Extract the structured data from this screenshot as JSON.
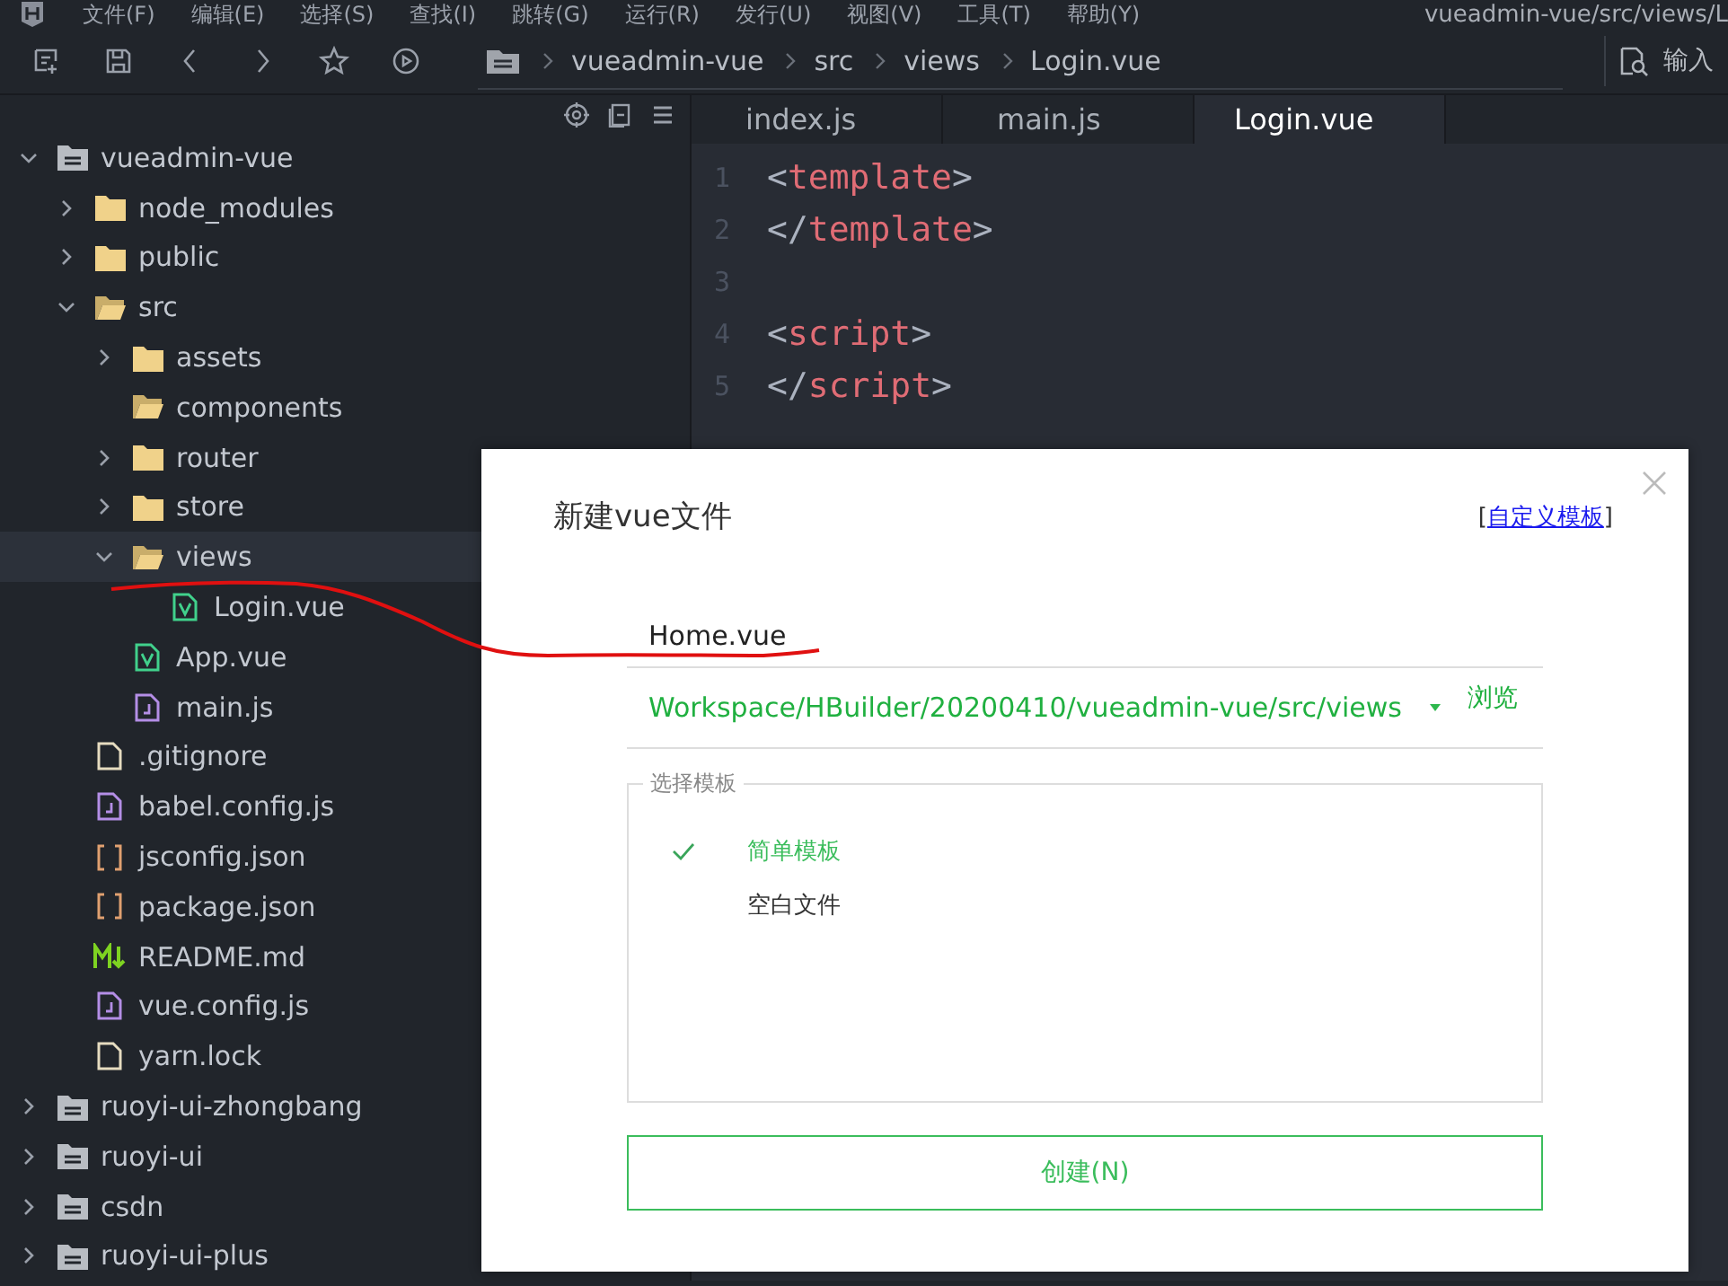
{
  "menu": [
    "文件(F)",
    "编辑(E)",
    "选择(S)",
    "查找(I)",
    "跳转(G)",
    "运行(R)",
    "发行(U)",
    "视图(V)",
    "工具(T)",
    "帮助(Y)"
  ],
  "window": {
    "title": "vueadmin-vue/src/views/L"
  },
  "toolbar": {
    "buttons": [
      {
        "kind": "new"
      },
      {
        "kind": "save"
      },
      {
        "kind": "back"
      },
      {
        "kind": "forward"
      },
      {
        "kind": "star"
      },
      {
        "kind": "run"
      }
    ],
    "breadcrumb": [
      "vueadmin-vue",
      "src",
      "views",
      "Login.vue"
    ],
    "search_placeholder": "输入"
  },
  "tree": [
    {
      "label": "vueadmin-vue",
      "kind": "project",
      "expanded": true,
      "selected": false,
      "children": [
        {
          "label": "node_modules",
          "kind": "folder",
          "expanded": false,
          "selected": false
        },
        {
          "label": "public",
          "kind": "folder",
          "expanded": false,
          "selected": false
        },
        {
          "label": "src",
          "kind": "folder",
          "expanded": true,
          "selected": false,
          "children": [
            {
              "label": "assets",
              "kind": "folder",
              "expanded": false,
              "selected": false
            },
            {
              "label": "components",
              "kind": "empty-folder",
              "selected": false
            },
            {
              "label": "router",
              "kind": "folder",
              "expanded": false,
              "selected": false
            },
            {
              "label": "store",
              "kind": "folder",
              "expanded": false,
              "selected": false
            },
            {
              "label": "views",
              "kind": "folder",
              "expanded": true,
              "selected": true,
              "children": [
                {
                  "label": "Login.vue",
                  "kind": "vue",
                  "selected": false
                }
              ]
            },
            {
              "label": "App.vue",
              "kind": "vue",
              "selected": false
            },
            {
              "label": "main.js",
              "kind": "js",
              "selected": false
            }
          ]
        },
        {
          "label": ".gitignore",
          "kind": "file",
          "selected": false
        },
        {
          "label": "babel.config.js",
          "kind": "js",
          "selected": false
        },
        {
          "label": "jsconfig.json",
          "kind": "json",
          "selected": false
        },
        {
          "label": "package.json",
          "kind": "json",
          "selected": false
        },
        {
          "label": "README.md",
          "kind": "md",
          "selected": false
        },
        {
          "label": "vue.config.js",
          "kind": "js",
          "selected": false
        },
        {
          "label": "yarn.lock",
          "kind": "file",
          "selected": false
        }
      ]
    },
    {
      "label": "ruoyi-ui-zhongbang",
      "kind": "project",
      "expanded": false,
      "selected": false
    },
    {
      "label": "ruoyi-ui",
      "kind": "project",
      "expanded": false,
      "selected": false
    },
    {
      "label": "csdn",
      "kind": "project",
      "expanded": false,
      "selected": false
    },
    {
      "label": "ruoyi-ui-plus",
      "kind": "project",
      "expanded": false,
      "selected": false
    }
  ],
  "tabs": [
    {
      "label": "index.js",
      "selected": false
    },
    {
      "label": "main.js",
      "selected": false
    },
    {
      "label": "Login.vue",
      "selected": true
    }
  ],
  "editor": {
    "lines": [
      {
        "number": "1",
        "tokens": [
          {
            "text": "<",
            "kind": "punct"
          },
          {
            "text": "template",
            "kind": "tag"
          },
          {
            "text": ">",
            "kind": "punct"
          }
        ]
      },
      {
        "number": "2",
        "tokens": [
          {
            "text": "</",
            "kind": "punct"
          },
          {
            "text": "template",
            "kind": "tag"
          },
          {
            "text": ">",
            "kind": "punct"
          }
        ]
      },
      {
        "number": "3"
      },
      {
        "number": "4",
        "tokens": [
          {
            "text": "<",
            "kind": "punct"
          },
          {
            "text": "script",
            "kind": "tag"
          },
          {
            "text": ">",
            "kind": "punct"
          }
        ]
      },
      {
        "number": "5",
        "tokens": [
          {
            "text": "</",
            "kind": "punct"
          },
          {
            "text": "script",
            "kind": "tag"
          },
          {
            "text": ">",
            "kind": "punct"
          }
        ]
      }
    ]
  },
  "dialog": {
    "title": "新建vue文件",
    "link": {
      "open": "[",
      "label": "自定义模板",
      "close": "]"
    },
    "filename": "Home.vue",
    "path": "Workspace/HBuilder/20200410/vueadmin-vue/src/views",
    "browse": "浏览",
    "template_group": "选择模板",
    "templates": [
      {
        "label": "简单模板",
        "selected": true
      },
      {
        "label": "空白文件",
        "selected": false
      }
    ],
    "create_button": "创建(N)"
  }
}
